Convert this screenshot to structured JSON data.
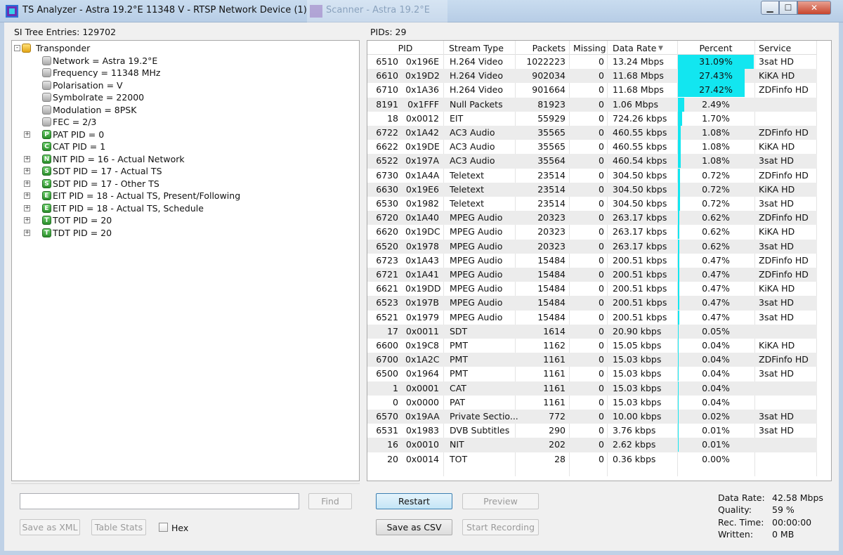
{
  "window": {
    "title": "TS Analyzer - Astra 19.2°E 11348 V - RTSP Network Device (1)",
    "background_title": "Scanner - Astra 19.2°E",
    "minimize_icon": "minimize-icon",
    "maximize_icon": "maximize-icon",
    "close_icon": "close-icon"
  },
  "tree": {
    "header": "SI Tree Entries: 129702",
    "items": [
      {
        "label": "Transponder",
        "level": 0,
        "icon": "folder",
        "expander": "-"
      },
      {
        "label": "Network = Astra 19.2°E",
        "level": 1,
        "icon": "gray",
        "expander": ""
      },
      {
        "label": "Frequency = 11348 MHz",
        "level": 1,
        "icon": "gray",
        "expander": ""
      },
      {
        "label": "Polarisation = V",
        "level": 1,
        "icon": "gray",
        "expander": ""
      },
      {
        "label": "Symbolrate = 22000",
        "level": 1,
        "icon": "gray",
        "expander": ""
      },
      {
        "label": "Modulation = 8PSK",
        "level": 1,
        "icon": "gray",
        "expander": ""
      },
      {
        "label": "FEC = 2/3",
        "level": 1,
        "icon": "gray",
        "expander": ""
      },
      {
        "label": "PAT PID = 0",
        "level": 1,
        "icon": "P",
        "expander": "+"
      },
      {
        "label": "CAT PID = 1",
        "level": 1,
        "icon": "C",
        "expander": ""
      },
      {
        "label": "NIT PID = 16 - Actual Network",
        "level": 1,
        "icon": "N",
        "expander": "+"
      },
      {
        "label": "SDT PID = 17 - Actual TS",
        "level": 1,
        "icon": "S",
        "expander": "+"
      },
      {
        "label": "SDT PID = 17 - Other TS",
        "level": 1,
        "icon": "S",
        "expander": "+"
      },
      {
        "label": "EIT PID = 18 - Actual TS, Present/Following",
        "level": 1,
        "icon": "E",
        "expander": "+"
      },
      {
        "label": "EIT PID = 18 - Actual TS, Schedule",
        "level": 1,
        "icon": "E",
        "expander": "+"
      },
      {
        "label": "TOT PID = 20",
        "level": 1,
        "icon": "T",
        "expander": "+"
      },
      {
        "label": "TDT PID = 20",
        "level": 1,
        "icon": "T",
        "expander": "+"
      }
    ]
  },
  "pids": {
    "header": "PIDs: 29",
    "columns": {
      "pid": "PID",
      "stream_type": "Stream Type",
      "packets": "Packets",
      "missing": "Missing",
      "data_rate": "Data Rate",
      "percent": "Percent",
      "service": "Service"
    },
    "sort_icon": "sort-down-icon",
    "rows": [
      {
        "pid": "6510",
        "hex": "0x196E",
        "type": "H.264 Video",
        "packets": "1022223",
        "missing": "0",
        "rate": "13.24 Mbps",
        "percent": "31.09%",
        "pct": 31.09,
        "service": "3sat HD"
      },
      {
        "pid": "6610",
        "hex": "0x19D2",
        "type": "H.264 Video",
        "packets": "902034",
        "missing": "0",
        "rate": "11.68 Mbps",
        "percent": "27.43%",
        "pct": 27.43,
        "service": "KiKA HD"
      },
      {
        "pid": "6710",
        "hex": "0x1A36",
        "type": "H.264 Video",
        "packets": "901664",
        "missing": "0",
        "rate": "11.68 Mbps",
        "percent": "27.42%",
        "pct": 27.42,
        "service": "ZDFinfo HD"
      },
      {
        "pid": "8191",
        "hex": "0x1FFF",
        "type": "Null Packets",
        "packets": "81923",
        "missing": "0",
        "rate": "1.06 Mbps",
        "percent": "2.49%",
        "pct": 2.49,
        "service": ""
      },
      {
        "pid": "18",
        "hex": "0x0012",
        "type": "EIT",
        "packets": "55929",
        "missing": "0",
        "rate": "724.26 kbps",
        "percent": "1.70%",
        "pct": 1.7,
        "service": ""
      },
      {
        "pid": "6722",
        "hex": "0x1A42",
        "type": "AC3 Audio",
        "packets": "35565",
        "missing": "0",
        "rate": "460.55 kbps",
        "percent": "1.08%",
        "pct": 1.08,
        "service": "ZDFinfo HD"
      },
      {
        "pid": "6622",
        "hex": "0x19DE",
        "type": "AC3 Audio",
        "packets": "35565",
        "missing": "0",
        "rate": "460.55 kbps",
        "percent": "1.08%",
        "pct": 1.08,
        "service": "KiKA HD"
      },
      {
        "pid": "6522",
        "hex": "0x197A",
        "type": "AC3 Audio",
        "packets": "35564",
        "missing": "0",
        "rate": "460.54 kbps",
        "percent": "1.08%",
        "pct": 1.08,
        "service": "3sat HD"
      },
      {
        "pid": "6730",
        "hex": "0x1A4A",
        "type": "Teletext",
        "packets": "23514",
        "missing": "0",
        "rate": "304.50 kbps",
        "percent": "0.72%",
        "pct": 0.72,
        "service": "ZDFinfo HD"
      },
      {
        "pid": "6630",
        "hex": "0x19E6",
        "type": "Teletext",
        "packets": "23514",
        "missing": "0",
        "rate": "304.50 kbps",
        "percent": "0.72%",
        "pct": 0.72,
        "service": "KiKA HD"
      },
      {
        "pid": "6530",
        "hex": "0x1982",
        "type": "Teletext",
        "packets": "23514",
        "missing": "0",
        "rate": "304.50 kbps",
        "percent": "0.72%",
        "pct": 0.72,
        "service": "3sat HD"
      },
      {
        "pid": "6720",
        "hex": "0x1A40",
        "type": "MPEG Audio",
        "packets": "20323",
        "missing": "0",
        "rate": "263.17 kbps",
        "percent": "0.62%",
        "pct": 0.62,
        "service": "ZDFinfo HD"
      },
      {
        "pid": "6620",
        "hex": "0x19DC",
        "type": "MPEG Audio",
        "packets": "20323",
        "missing": "0",
        "rate": "263.17 kbps",
        "percent": "0.62%",
        "pct": 0.62,
        "service": "KiKA HD"
      },
      {
        "pid": "6520",
        "hex": "0x1978",
        "type": "MPEG Audio",
        "packets": "20323",
        "missing": "0",
        "rate": "263.17 kbps",
        "percent": "0.62%",
        "pct": 0.62,
        "service": "3sat HD"
      },
      {
        "pid": "6723",
        "hex": "0x1A43",
        "type": "MPEG Audio",
        "packets": "15484",
        "missing": "0",
        "rate": "200.51 kbps",
        "percent": "0.47%",
        "pct": 0.47,
        "service": "ZDFinfo HD"
      },
      {
        "pid": "6721",
        "hex": "0x1A41",
        "type": "MPEG Audio",
        "packets": "15484",
        "missing": "0",
        "rate": "200.51 kbps",
        "percent": "0.47%",
        "pct": 0.47,
        "service": "ZDFinfo HD"
      },
      {
        "pid": "6621",
        "hex": "0x19DD",
        "type": "MPEG Audio",
        "packets": "15484",
        "missing": "0",
        "rate": "200.51 kbps",
        "percent": "0.47%",
        "pct": 0.47,
        "service": "KiKA HD"
      },
      {
        "pid": "6523",
        "hex": "0x197B",
        "type": "MPEG Audio",
        "packets": "15484",
        "missing": "0",
        "rate": "200.51 kbps",
        "percent": "0.47%",
        "pct": 0.47,
        "service": "3sat HD"
      },
      {
        "pid": "6521",
        "hex": "0x1979",
        "type": "MPEG Audio",
        "packets": "15484",
        "missing": "0",
        "rate": "200.51 kbps",
        "percent": "0.47%",
        "pct": 0.47,
        "service": "3sat HD"
      },
      {
        "pid": "17",
        "hex": "0x0011",
        "type": "SDT",
        "packets": "1614",
        "missing": "0",
        "rate": "20.90 kbps",
        "percent": "0.05%",
        "pct": 0.05,
        "service": ""
      },
      {
        "pid": "6600",
        "hex": "0x19C8",
        "type": "PMT",
        "packets": "1162",
        "missing": "0",
        "rate": "15.05 kbps",
        "percent": "0.04%",
        "pct": 0.04,
        "service": "KiKA HD"
      },
      {
        "pid": "6700",
        "hex": "0x1A2C",
        "type": "PMT",
        "packets": "1161",
        "missing": "0",
        "rate": "15.03 kbps",
        "percent": "0.04%",
        "pct": 0.04,
        "service": "ZDFinfo HD"
      },
      {
        "pid": "6500",
        "hex": "0x1964",
        "type": "PMT",
        "packets": "1161",
        "missing": "0",
        "rate": "15.03 kbps",
        "percent": "0.04%",
        "pct": 0.04,
        "service": "3sat HD"
      },
      {
        "pid": "1",
        "hex": "0x0001",
        "type": "CAT",
        "packets": "1161",
        "missing": "0",
        "rate": "15.03 kbps",
        "percent": "0.04%",
        "pct": 0.04,
        "service": ""
      },
      {
        "pid": "0",
        "hex": "0x0000",
        "type": "PAT",
        "packets": "1161",
        "missing": "0",
        "rate": "15.03 kbps",
        "percent": "0.04%",
        "pct": 0.04,
        "service": ""
      },
      {
        "pid": "6570",
        "hex": "0x19AA",
        "type": "Private Sectio...",
        "packets": "772",
        "missing": "0",
        "rate": "10.00 kbps",
        "percent": "0.02%",
        "pct": 0.02,
        "service": "3sat HD"
      },
      {
        "pid": "6531",
        "hex": "0x1983",
        "type": "DVB Subtitles",
        "packets": "290",
        "missing": "0",
        "rate": "3.76 kbps",
        "percent": "0.01%",
        "pct": 0.01,
        "service": "3sat HD"
      },
      {
        "pid": "16",
        "hex": "0x0010",
        "type": "NIT",
        "packets": "202",
        "missing": "0",
        "rate": "2.62 kbps",
        "percent": "0.01%",
        "pct": 0.01,
        "service": ""
      },
      {
        "pid": "20",
        "hex": "0x0014",
        "type": "TOT",
        "packets": "28",
        "missing": "0",
        "rate": "0.36 kbps",
        "percent": "0.00%",
        "pct": 0.0,
        "service": ""
      }
    ]
  },
  "search": {
    "value": "",
    "find_label": "Find"
  },
  "left_buttons": {
    "save_xml": "Save as XML",
    "table_stats": "Table Stats",
    "hex_label": "Hex",
    "hex_checked": false
  },
  "right_buttons": {
    "restart": "Restart",
    "preview": "Preview",
    "save_csv": "Save as CSV",
    "start_recording": "Start Recording"
  },
  "stats": [
    {
      "label": "Data Rate:",
      "value": "42.58 Mbps"
    },
    {
      "label": "Quality:",
      "value": "59 %"
    },
    {
      "label": "Rec. Time:",
      "value": "00:00:00"
    },
    {
      "label": "Written:",
      "value": "0 MB"
    }
  ],
  "colors": {
    "percent_bar": "#12e6f0",
    "alt_row": "#ececec"
  }
}
